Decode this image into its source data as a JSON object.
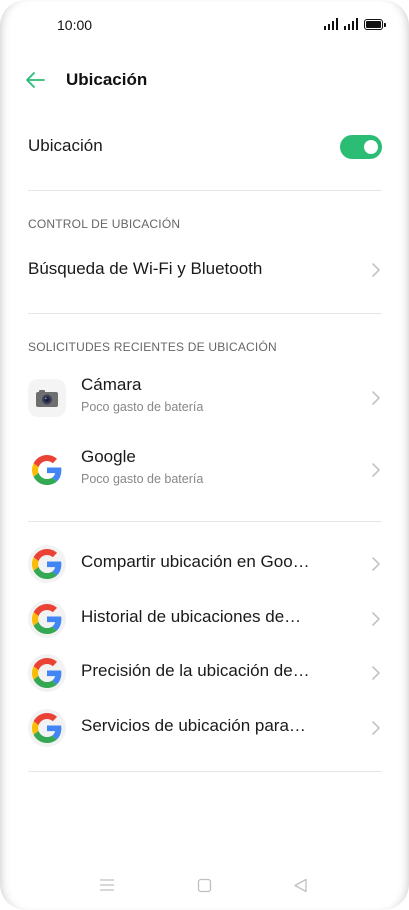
{
  "status_bar": {
    "time": "10:00"
  },
  "app_bar": {
    "title": "Ubicación"
  },
  "location_toggle": {
    "label": "Ubicación",
    "on": true
  },
  "location_control": {
    "header": "CONTROL DE UBICACIÓN",
    "wifi_bt_scan": "Búsqueda de Wi-Fi y Bluetooth"
  },
  "recent_requests": {
    "header": "SOLICITUDES RECIENTES DE UBICACIÓN",
    "apps": [
      {
        "name": "Cámara",
        "subtitle": "Poco gasto de batería",
        "icon": "camera-icon"
      },
      {
        "name": "Google",
        "subtitle": "Poco gasto de batería",
        "icon": "google-icon"
      }
    ]
  },
  "google_services": [
    {
      "label": "Compartir ubicación en Goo…",
      "icon": "google-icon"
    },
    {
      "label": "Historial de ubicaciones de…",
      "icon": "google-icon"
    },
    {
      "label": "Precisión de la ubicación de…",
      "icon": "google-icon"
    },
    {
      "label": "Servicios de ubicación para…",
      "icon": "google-icon"
    }
  ],
  "colors": {
    "accent": "#2bbd74",
    "divider": "#e6e6e6",
    "secondary_text": "#888888"
  }
}
